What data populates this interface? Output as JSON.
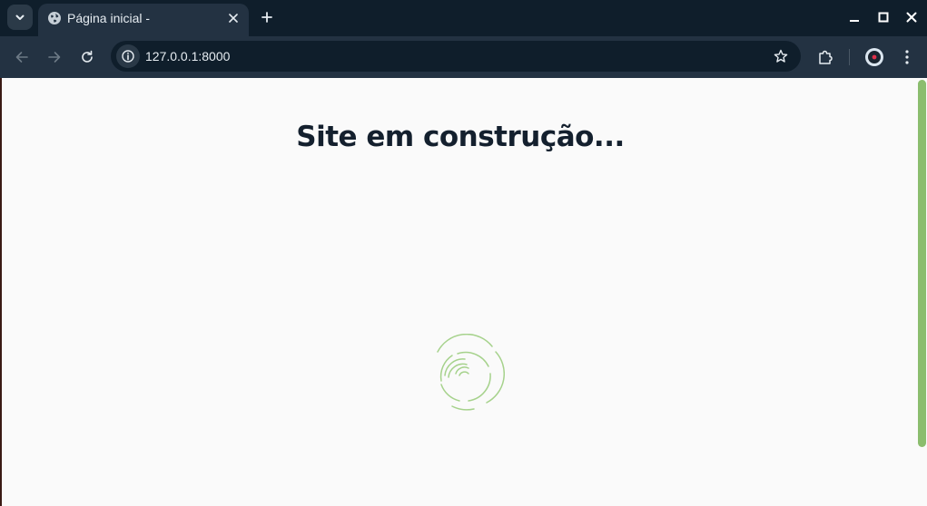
{
  "browser": {
    "tab": {
      "title": "Página inicial -",
      "favicon": "globe-icon"
    },
    "address_bar": {
      "url": "127.0.0.1:8000"
    },
    "icons": {
      "tab_search": "chevron-down-icon",
      "close_tab": "close-icon",
      "new_tab": "plus-icon",
      "back": "arrow-left-icon",
      "forward": "arrow-right-icon",
      "reload": "reload-icon",
      "site_info": "info-icon",
      "bookmark": "star-icon",
      "extensions": "puzzle-icon",
      "profile": "avatar-icon",
      "menu": "kebab-menu-icon",
      "minimize": "minimize-icon",
      "maximize": "maximize-icon",
      "close_window": "close-icon"
    }
  },
  "page": {
    "title": "Site em construção...",
    "loader": "spinner-icon"
  },
  "colors": {
    "accent": "#8bbd6e",
    "loader": "#a6d28c",
    "title_text": "#14202e",
    "page_background": "#fafafa",
    "chrome_background": "#0f1e2b",
    "toolbar_background": "#233242"
  }
}
